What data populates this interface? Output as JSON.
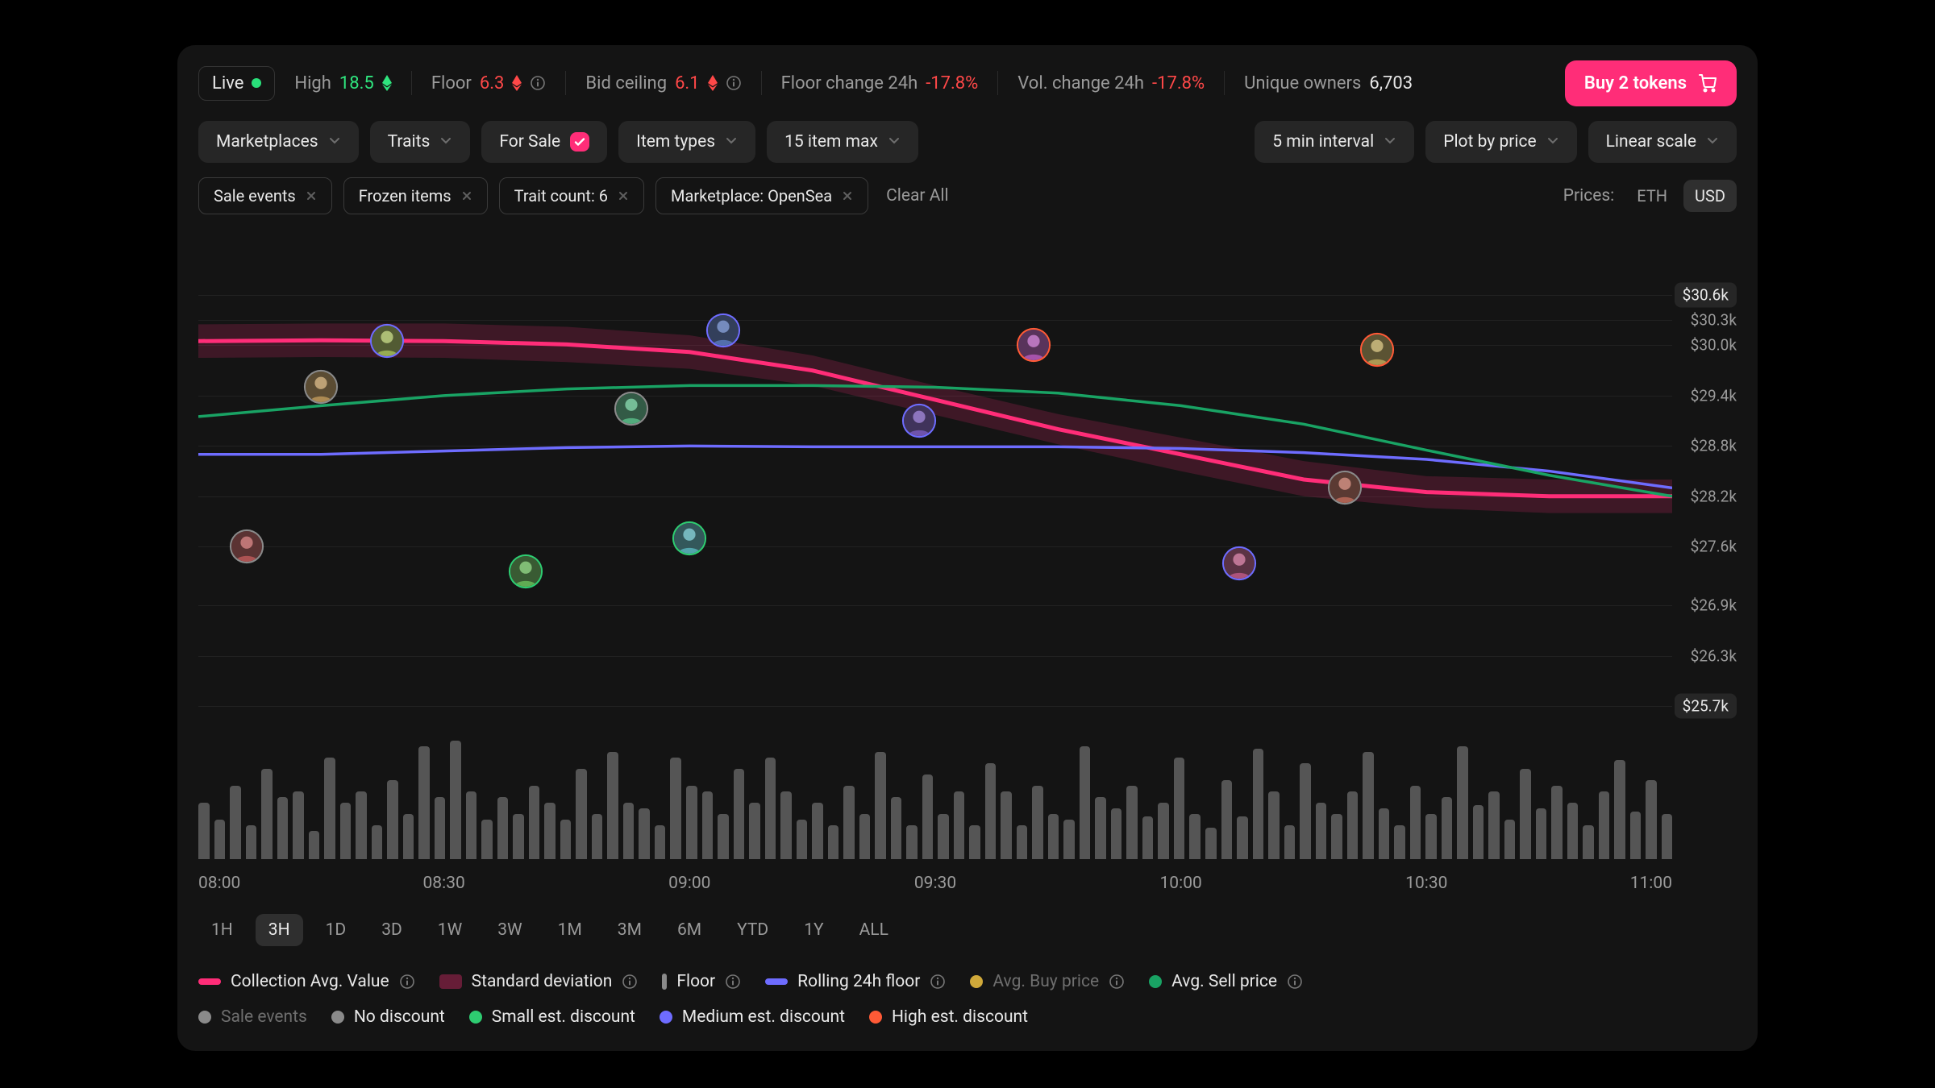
{
  "header": {
    "live_label": "Live",
    "stats": {
      "high_label": "High",
      "high_value": "18.5",
      "floor_label": "Floor",
      "floor_value": "6.3",
      "bid_label": "Bid ceiling",
      "bid_value": "6.1",
      "floor_change_label": "Floor change 24h",
      "floor_change_value": "-17.8%",
      "vol_change_label": "Vol. change 24h",
      "vol_change_value": "-17.8%",
      "owners_label": "Unique owners",
      "owners_value": "6,703"
    },
    "buy_label": "Buy 2 tokens"
  },
  "filters_row1": {
    "marketplaces": "Marketplaces",
    "traits": "Traits",
    "for_sale": "For Sale",
    "item_types": "Item types",
    "item_max": "15 item max",
    "interval": "5 min interval",
    "plot_by": "Plot by price",
    "scale": "Linear scale"
  },
  "filters_row2": {
    "chips": [
      "Sale events",
      "Frozen items",
      "Trait count: 6",
      "Marketplace: OpenSea"
    ],
    "clear": "Clear All",
    "prices_label": "Prices:",
    "currencies": [
      "ETH",
      "USD"
    ],
    "active_currency": "USD"
  },
  "chart_data": {
    "type": "line",
    "xlabel": "",
    "ylabel": "",
    "ylim": [
      25700,
      30600
    ],
    "y_ticks": [
      "$30.6k",
      "$30.3k",
      "$30.0k",
      "$29.4k",
      "$28.8k",
      "$28.2k",
      "$27.6k",
      "$26.9k",
      "$26.3k",
      "$25.7k"
    ],
    "x_categories": [
      "08:00",
      "08:30",
      "09:00",
      "09:30",
      "10:00",
      "10:30",
      "11:00"
    ],
    "series": [
      {
        "name": "Collection Avg. Value",
        "color": "#ff2d78",
        "values": [
          30050,
          30060,
          30050,
          30010,
          29920,
          29700,
          29350,
          29000,
          28700,
          28400,
          28250,
          28200,
          28200
        ]
      },
      {
        "name": "Standard deviation band",
        "color": "rgba(255,45,120,0.18)",
        "type": "area",
        "upper": [
          30250,
          30260,
          30260,
          30220,
          30120,
          29880,
          29520,
          29180,
          28900,
          28620,
          28440,
          28400,
          28400
        ],
        "lower": [
          29850,
          29860,
          29850,
          29800,
          29720,
          29520,
          29170,
          28820,
          28500,
          28200,
          28060,
          28000,
          28000
        ]
      },
      {
        "name": "Rolling 24h floor",
        "color": "#6e6cff",
        "values": [
          28700,
          28700,
          28740,
          28780,
          28800,
          28790,
          28790,
          28790,
          28770,
          28720,
          28640,
          28500,
          28300
        ]
      },
      {
        "name": "Avg. Sell price",
        "color": "#19a364",
        "values": [
          29150,
          29280,
          29400,
          29480,
          29520,
          29520,
          29500,
          29430,
          29280,
          29060,
          28750,
          28450,
          28200
        ]
      }
    ],
    "events": [
      {
        "time": "08:06",
        "x_pct": 3.3,
        "value": 27600,
        "class": "no-discount",
        "color": "#8a8a8a"
      },
      {
        "time": "08:15",
        "x_pct": 8.3,
        "value": 29500,
        "class": "no-discount",
        "color": "#8a8a8a"
      },
      {
        "time": "08:23",
        "x_pct": 12.8,
        "value": 30050,
        "class": "medium",
        "color": "#6e6cff"
      },
      {
        "time": "08:40",
        "x_pct": 22.2,
        "value": 27300,
        "class": "small",
        "color": "#2ecc71"
      },
      {
        "time": "08:53",
        "x_pct": 29.4,
        "value": 29250,
        "class": "no-discount",
        "color": "#8a8a8a"
      },
      {
        "time": "09:00",
        "x_pct": 33.3,
        "value": 27700,
        "class": "small",
        "color": "#2ecc71"
      },
      {
        "time": "09:04",
        "x_pct": 35.6,
        "value": 30180,
        "class": "medium",
        "color": "#6e6cff"
      },
      {
        "time": "09:28",
        "x_pct": 48.9,
        "value": 29100,
        "class": "medium",
        "color": "#6e6cff"
      },
      {
        "time": "09:42",
        "x_pct": 56.7,
        "value": 30000,
        "class": "high",
        "color": "#ff5a36"
      },
      {
        "time": "10:07",
        "x_pct": 70.6,
        "value": 27400,
        "class": "medium",
        "color": "#6e6cff"
      },
      {
        "time": "10:20",
        "x_pct": 77.8,
        "value": 28300,
        "class": "no-discount",
        "color": "#8a8a8a"
      },
      {
        "time": "10:24",
        "x_pct": 80.0,
        "value": 29950,
        "class": "high",
        "color": "#ff5a36"
      }
    ],
    "volume_bars": [
      50,
      35,
      65,
      30,
      80,
      55,
      60,
      25,
      90,
      50,
      60,
      30,
      70,
      40,
      100,
      55,
      105,
      60,
      35,
      55,
      40,
      65,
      50,
      35,
      80,
      40,
      95,
      50,
      45,
      30,
      90,
      65,
      60,
      40,
      80,
      50,
      90,
      60,
      35,
      50,
      30,
      65,
      40,
      95,
      55,
      30,
      75,
      40,
      60,
      30,
      85,
      60,
      30,
      65,
      40,
      35,
      100,
      55,
      45,
      65,
      38,
      50,
      90,
      40,
      28,
      70,
      38,
      98,
      60,
      30,
      85,
      50,
      40,
      60,
      95,
      45,
      30,
      65,
      40,
      55,
      100,
      48,
      60,
      35,
      80,
      45,
      65,
      50,
      30,
      60,
      88,
      42,
      70,
      40
    ]
  },
  "ranges": {
    "options": [
      "1H",
      "3H",
      "1D",
      "3D",
      "1W",
      "3W",
      "1M",
      "3M",
      "6M",
      "YTD",
      "1Y",
      "ALL"
    ],
    "active": "3H"
  },
  "legend1": [
    {
      "label": "Collection Avg. Value",
      "color": "#ff2d78",
      "shape": "line",
      "info": true
    },
    {
      "label": "Standard deviation",
      "color": "#ff2d78",
      "shape": "block",
      "info": true,
      "alpha": 0.35
    },
    {
      "label": "Floor",
      "color": "#8a8a8a",
      "shape": "dash",
      "info": true
    },
    {
      "label": "Rolling 24h floor",
      "color": "#6e6cff",
      "shape": "line",
      "info": true
    },
    {
      "label": "Avg. Buy price",
      "color": "#d0a93a",
      "shape": "dot",
      "info": true,
      "dim": true
    },
    {
      "label": "Avg. Sell price",
      "color": "#19a364",
      "shape": "dot",
      "info": true
    }
  ],
  "legend2": [
    {
      "label": "Sale events",
      "color": "#8a8a8a",
      "shape": "dot",
      "dim": true
    },
    {
      "label": "No discount",
      "color": "#8a8a8a",
      "shape": "dot"
    },
    {
      "label": "Small est. discount",
      "color": "#2ecc71",
      "shape": "dot"
    },
    {
      "label": "Medium est. discount",
      "color": "#6e6cff",
      "shape": "dot"
    },
    {
      "label": "High est. discount",
      "color": "#ff5a36",
      "shape": "dot"
    }
  ]
}
